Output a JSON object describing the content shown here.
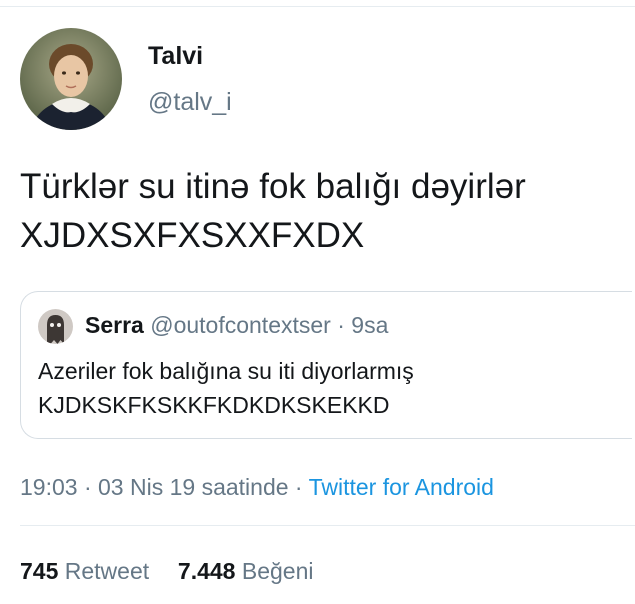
{
  "tweet": {
    "author": {
      "display_name": "Talvi",
      "handle": "@talv_i",
      "avatar_icon": "child-portrait-avatar"
    },
    "text_lines": [
      "Türklər su itinə fok balığı dəyirlər",
      "XJDXSXFXSXXFXDX"
    ],
    "quoted": {
      "author_name": "Serra",
      "author_handle": "@outofcontextser",
      "separator": "·",
      "time": "9sa",
      "avatar_icon": "ghost-avatar",
      "text_lines": [
        "Azeriler fok balığına su iti diyorlarmış",
        "KJDKSKFKSKKFKDKDKSKEKKD"
      ]
    },
    "meta": {
      "time": "19:03",
      "sep1": "·",
      "date": "03 Nis 19 saatinde",
      "sep2": "·",
      "source": "Twitter for Android"
    },
    "stats": {
      "retweet_count": "745",
      "retweet_label": "Retweet",
      "like_count": "7.448",
      "like_label": "Beğeni"
    }
  },
  "colors": {
    "text": "#14171a",
    "secondary": "#657786",
    "link": "#1b95e0",
    "border": "#e6ecf0"
  }
}
